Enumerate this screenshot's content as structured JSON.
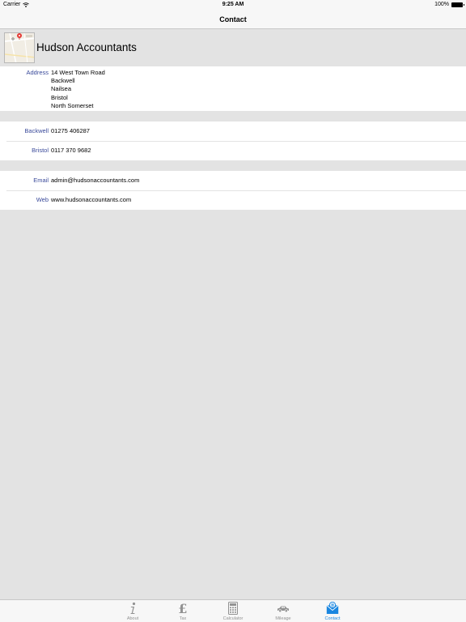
{
  "status_bar": {
    "carrier": "Carrier",
    "time": "9:25 AM",
    "battery": "100%"
  },
  "nav": {
    "title": "Contact"
  },
  "company": {
    "name": "Hudson Accountants",
    "map_thumbnail_icon": "map-pin-icon"
  },
  "address": {
    "label": "Address",
    "lines": [
      "14 West Town Road",
      "Backwell",
      "Nailsea",
      "Bristol",
      "North Somerset"
    ]
  },
  "phones": [
    {
      "label": "Backwell",
      "value": "01275 406287"
    },
    {
      "label": "Bristol",
      "value": "0117 370 9682"
    }
  ],
  "online": [
    {
      "label": "Email",
      "value": "admin@hudsonaccountants.com"
    },
    {
      "label": "Web",
      "value": "www.hudsonaccountants.com"
    }
  ],
  "tabs": [
    {
      "label": "About",
      "icon": "info-icon",
      "active": false
    },
    {
      "label": "Tax",
      "icon": "pound-icon",
      "active": false
    },
    {
      "label": "Calculator",
      "icon": "calculator-icon",
      "active": false
    },
    {
      "label": "Mileage",
      "icon": "car-icon",
      "active": false
    },
    {
      "label": "Contact",
      "icon": "envelope-icon",
      "active": true
    }
  ],
  "colors": {
    "label_text": "#3a4a9a",
    "active_tab": "#1a86e0",
    "inactive_tab": "#929292",
    "background": "#e3e3e3"
  }
}
